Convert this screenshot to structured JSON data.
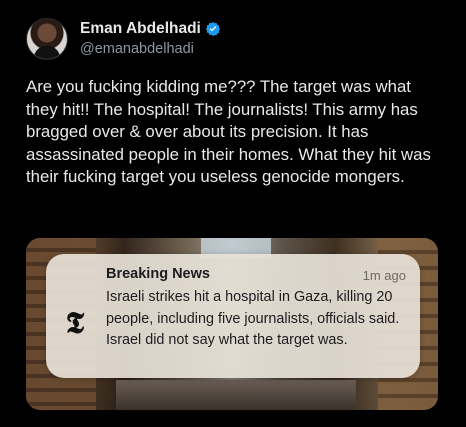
{
  "author": {
    "display_name": "Eman Abdelhadi",
    "handle": "@emanabdelhadi",
    "verified": true
  },
  "tweet": {
    "text": "Are you fucking kidding me??? The target was what they hit!! The hospital! The journalists! This army has bragged over & over about its precision. It has assassinated people in their homes. What they hit was their fucking target you useless genocide mongers."
  },
  "notification": {
    "app_icon": "nyt-logo",
    "title": "Breaking News",
    "time": "1m ago",
    "body": "Israeli strikes hit a hospital in Gaza, killing 20 people, including five journalists, officials said. Israel did not say what the target was."
  },
  "colors": {
    "background": "#000000",
    "text": "#e7e9ea",
    "handle": "#8b98a5",
    "verified": "#1d9bf0"
  }
}
